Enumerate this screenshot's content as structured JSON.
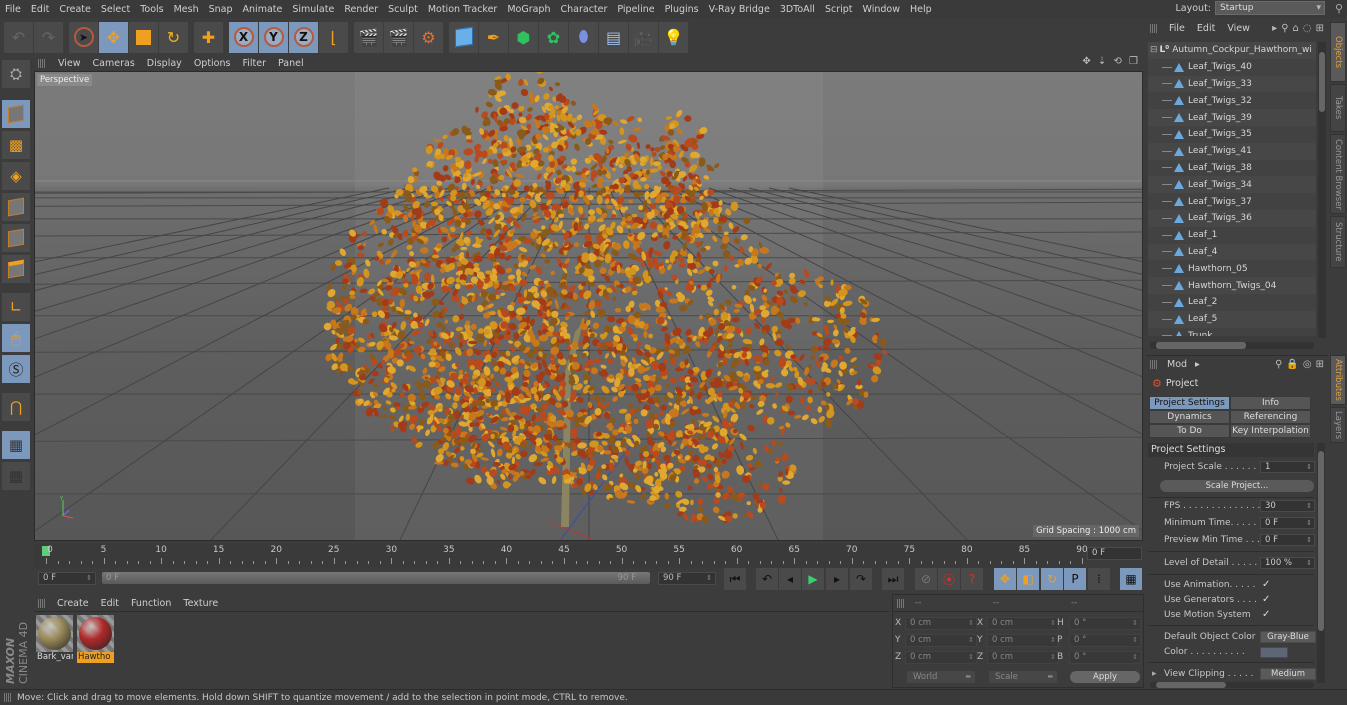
{
  "menubar": {
    "items": [
      "File",
      "Edit",
      "Create",
      "Select",
      "Tools",
      "Mesh",
      "Snap",
      "Animate",
      "Simulate",
      "Render",
      "Sculpt",
      "Motion Tracker",
      "MoGraph",
      "Character",
      "Pipeline",
      "Plugins",
      "V-Ray Bridge",
      "3DToAll",
      "Script",
      "Window",
      "Help"
    ],
    "layout_label": "Layout:",
    "layout_value": "Startup"
  },
  "toolbar": {
    "groups": [
      [
        "undo-icon",
        "redo-icon"
      ],
      [
        "live-selection-icon",
        "move-icon",
        "scale-icon",
        "rotate-icon"
      ],
      [
        "recent-tool-icon"
      ],
      [
        "x-axis-lock-icon",
        "y-axis-lock-icon",
        "z-axis-lock-icon",
        "coordinate-system-icon"
      ],
      [
        "render-view-icon",
        "render-to-picture-viewer-icon",
        "render-settings-icon"
      ],
      [
        "cube-icon",
        "pen-spline-icon",
        "subdivision-surface-icon",
        "array-icon",
        "deformer-icon",
        "floor-icon",
        "camera-icon",
        "light-icon"
      ]
    ],
    "axis_labels": [
      "X",
      "Y",
      "Z"
    ]
  },
  "left_toolbar": {
    "items": [
      "make-editable-icon",
      "model-mode-icon",
      "texture-mode-icon",
      "workplane-icon",
      "points-mode-icon",
      "edges-mode-icon",
      "polygons-mode-icon",
      "axis-mode-icon",
      "tweak-mode-icon",
      "solo-icon",
      "snap-icon",
      "lock-workplane-icon",
      "planar-workplane-icon"
    ]
  },
  "viewport": {
    "menu": [
      "View",
      "Cameras",
      "Display",
      "Options",
      "Filter",
      "Panel"
    ],
    "camera_label": "Perspective",
    "grid_spacing": "Grid Spacing : 1000 cm",
    "foliage_colors": [
      "#c8781c",
      "#d4951f",
      "#b84a1e",
      "#e0a830",
      "#a33a18",
      "#8a5a1a"
    ],
    "trunk_color": "#8a8560"
  },
  "timeline": {
    "ticks": [
      0,
      5,
      10,
      15,
      20,
      25,
      30,
      35,
      40,
      45,
      50,
      55,
      60,
      65,
      70,
      75,
      80,
      85,
      90
    ],
    "current_frame": "0 F",
    "start_field": "0 F",
    "range_start": "0 F",
    "range_end": "90 F",
    "end_field": "90 F",
    "playhead_frame": 0,
    "max_frame": 90
  },
  "playback": {
    "buttons": [
      {
        "name": "go-to-start-icon",
        "glyph": "⏮"
      },
      {
        "name": "previous-key-icon",
        "glyph": "↶"
      },
      {
        "name": "previous-frame-icon",
        "glyph": "◂"
      },
      {
        "name": "play-icon",
        "glyph": "▶"
      },
      {
        "name": "next-frame-icon",
        "glyph": "▸"
      },
      {
        "name": "next-key-icon",
        "glyph": "↷"
      },
      {
        "name": "go-to-end-icon",
        "glyph": "⏭"
      },
      {
        "name": "record-active-icon",
        "glyph": "⊘"
      },
      {
        "name": "autokey-icon",
        "glyph": "⦿"
      },
      {
        "name": "keyframe-selection-icon",
        "glyph": "?"
      },
      {
        "name": "record-position-icon",
        "glyph": "✥"
      },
      {
        "name": "record-scale-icon",
        "glyph": "◧"
      },
      {
        "name": "record-rotation-icon",
        "glyph": "↻"
      },
      {
        "name": "record-parameter-icon",
        "glyph": "P"
      },
      {
        "name": "record-pla-icon",
        "glyph": "⁞"
      },
      {
        "name": "timeline-icon",
        "glyph": "▦"
      }
    ]
  },
  "material_manager": {
    "menu": [
      "Create",
      "Edit",
      "Function",
      "Texture"
    ],
    "materials": [
      {
        "name": "Bark_var",
        "color": "#9a8a5a",
        "selected": false
      },
      {
        "name": "Hawtho",
        "color": "#b02a2a",
        "selected": true
      }
    ]
  },
  "brand": {
    "maxon": "MAXON",
    "cinema": "CINEMA 4D"
  },
  "coordinates": {
    "headers": [
      "--",
      "--",
      "--"
    ],
    "rows": [
      {
        "a1": "X",
        "v1": "0 cm",
        "a2": "X",
        "v2": "0 cm",
        "a3": "H",
        "v3": "0 °"
      },
      {
        "a1": "Y",
        "v1": "0 cm",
        "a2": "Y",
        "v2": "0 cm",
        "a3": "P",
        "v3": "0 °"
      },
      {
        "a1": "Z",
        "v1": "0 cm",
        "a2": "Z",
        "v2": "0 cm",
        "a3": "B",
        "v3": "0 °"
      }
    ],
    "space": "World",
    "mode": "Scale",
    "apply": "Apply"
  },
  "status": "Move: Click and drag to move elements. Hold down SHIFT to quantize movement / add to the selection in point mode, CTRL to remove.",
  "object_manager": {
    "menu": [
      "File",
      "Edit",
      "View"
    ],
    "root": "Autumn_Cockpur_Hawthorn_wi",
    "children": [
      "Leaf_Twigs_40",
      "Leaf_Twigs_33",
      "Leaf_Twigs_32",
      "Leaf_Twigs_39",
      "Leaf_Twigs_35",
      "Leaf_Twigs_41",
      "Leaf_Twigs_38",
      "Leaf_Twigs_34",
      "Leaf_Twigs_37",
      "Leaf_Twigs_36",
      "Leaf_1",
      "Leaf_4",
      "Hawthorn_05",
      "Hawthorn_Twigs_04",
      "Leaf_2",
      "Leaf_5",
      "Trunk"
    ]
  },
  "right_tabs_top": [
    {
      "label": "Objects",
      "active": true
    },
    {
      "label": "Takes",
      "active": false
    },
    {
      "label": "Content Browser",
      "active": false
    },
    {
      "label": "Structure",
      "active": false
    }
  ],
  "right_tabs_bottom": [
    {
      "label": "Attributes",
      "active": true
    },
    {
      "label": "Layers",
      "active": false
    }
  ],
  "attributes": {
    "mode": "Mod",
    "title": "Project",
    "tabs": [
      {
        "label": "Project Settings",
        "active": true
      },
      {
        "label": "Info",
        "active": false
      },
      {
        "label": "Dynamics",
        "active": false
      },
      {
        "label": "Referencing",
        "active": false
      },
      {
        "label": "To Do",
        "active": false
      },
      {
        "label": "Key Interpolation",
        "active": false
      }
    ],
    "section": "Project Settings",
    "project_scale_label": "Project Scale . . . . . .",
    "project_scale": "1",
    "scale_project_button": "Scale Project...",
    "fps_label": "FPS . . . . . . . . . . . . . .",
    "fps": "30",
    "min_time_label": "Minimum Time. . . . .",
    "min_time": "0 F",
    "preview_min_label": "Preview Min Time . . .",
    "preview_min": "0 F",
    "lod_label": "Level of Detail . . . . .",
    "lod": "100 %",
    "use_animation_label": "Use Animation. . . . .",
    "use_animation": "✓",
    "use_generators_label": "Use Generators . . . .",
    "use_generators": "✓",
    "use_motion_label": "Use Motion System",
    "use_motion": "✓",
    "default_color_label": "Default Object Color",
    "default_color": "Gray-Blue",
    "color_label": "Color . . . . . . . . . .",
    "color_swatch": "#5d6677",
    "view_clipping_label": "View Clipping . . . . .",
    "view_clipping": "Medium"
  }
}
